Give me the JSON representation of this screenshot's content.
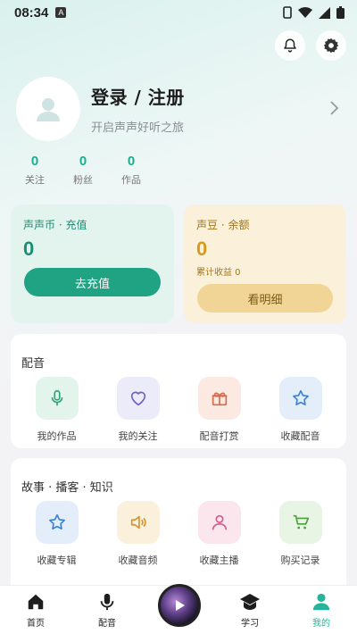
{
  "status_bar": {
    "time": "08:34",
    "badge": "A"
  },
  "profile": {
    "title": "登录 / 注册",
    "subtitle": "开启声声好听之旅"
  },
  "stats": [
    {
      "value": "0",
      "label": "关注"
    },
    {
      "value": "0",
      "label": "粉丝"
    },
    {
      "value": "0",
      "label": "作品"
    }
  ],
  "wallet": {
    "coins": {
      "title": "声声币 · 充值",
      "amount": "0",
      "button": "去充值"
    },
    "beans": {
      "title": "声豆 · 余额",
      "amount": "0",
      "earnings": "累计收益 0",
      "button": "看明细"
    }
  },
  "dubbing": {
    "title": "配音",
    "items": [
      {
        "label": "我的作品",
        "icon": "mic-icon"
      },
      {
        "label": "我的关注",
        "icon": "heart-icon"
      },
      {
        "label": "配音打赏",
        "icon": "gift-icon"
      },
      {
        "label": "收藏配音",
        "icon": "star-icon"
      }
    ]
  },
  "stories": {
    "title": "故事 · 播客 · 知识",
    "items": [
      {
        "label": "收藏专辑",
        "icon": "star-icon"
      },
      {
        "label": "收藏音频",
        "icon": "speaker-icon"
      },
      {
        "label": "收藏主播",
        "icon": "person-icon"
      },
      {
        "label": "购买记录",
        "icon": "cart-icon"
      }
    ]
  },
  "tabbar": {
    "items": [
      {
        "label": "首页",
        "icon": "home-icon"
      },
      {
        "label": "配音",
        "icon": "mic-icon"
      },
      {
        "label": "学习",
        "icon": "graduation-cap-icon"
      },
      {
        "label": "我的",
        "icon": "person-icon"
      }
    ],
    "active": "我的"
  },
  "colors": {
    "accent": "#1fa383",
    "gold": "#f1d596",
    "active_tab": "#25b59a"
  }
}
